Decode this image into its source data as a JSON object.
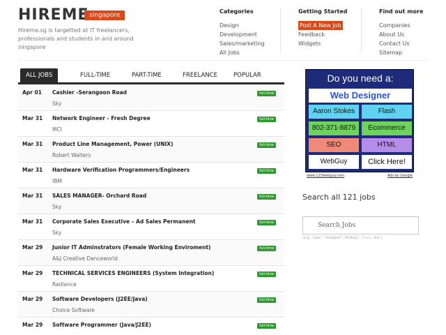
{
  "header": {
    "logo": "HIREME",
    "locale": "singapore",
    "tagline": "Hireme.sg is targetted at IT freelancers, professionals and students in and around singapore"
  },
  "nav": {
    "categories": {
      "heading": "Categories",
      "items": [
        "Design",
        "Development",
        "Sales/marketing",
        "All Jobs"
      ]
    },
    "getting_started": {
      "heading": "Getting Started",
      "items": [
        "Post A New Job",
        "Feedback",
        "Widgets"
      ]
    },
    "find_out_more": {
      "heading": "Find out more",
      "items": [
        "Companies",
        "About Us",
        "Contact Us",
        "Sitemap"
      ]
    }
  },
  "tabs": [
    "ALL JOBS",
    "FULL-TIME",
    "PART-TIME",
    "FREELANCE",
    "POPULAR"
  ],
  "jobs": [
    {
      "date": "Apr 01",
      "title": "Cashier -Serangoon Road",
      "company": "Sky",
      "type": "full-time"
    },
    {
      "date": "Mar 31",
      "title": "Network Engineer - Fresh Degree",
      "company": "MCI",
      "type": "full-time"
    },
    {
      "date": "Mar 31",
      "title": "Product Line Management, Power (UNIX)",
      "company": "Robert Walters",
      "type": "full-time"
    },
    {
      "date": "Mar 31",
      "title": "Hardware Verification Programmers/Engineers",
      "company": "IBM",
      "type": "full-time"
    },
    {
      "date": "Mar 31",
      "title": "SALES MANAGER- Orchard Road",
      "company": "Sky",
      "type": "full-time"
    },
    {
      "date": "Mar 31",
      "title": "Corporate Sales Executive – Ad Sales Permanent",
      "company": "Sky",
      "type": "full-time"
    },
    {
      "date": "Mar 29",
      "title": "Junior IT Adminstrators (Female Working Enviroment)",
      "company": "A&J Creative Danceworld",
      "type": "full-time"
    },
    {
      "date": "Mar 29",
      "title": "TECHNICAL SERVICES ENGINEERS (System Integration)",
      "company": "Radiance",
      "type": "full-time"
    },
    {
      "date": "Mar 29",
      "title": "Software Developers (J2EE/Java)",
      "company": "Choice Software",
      "type": "full-time"
    },
    {
      "date": "Mar 29",
      "title": "Software Programmer (Java/J2EE)",
      "company": "",
      "type": "full-time"
    }
  ],
  "ad": {
    "title": "Do you need a:",
    "headline": "Web Designer",
    "cells": [
      {
        "text": "Aaron Stokes",
        "bg": "#5fd3f0",
        "color": "#111111"
      },
      {
        "text": "Flash",
        "bg": "#5fd3f0",
        "color": "#111111"
      },
      {
        "text": "802-371-8879",
        "bg": "#6ed25c",
        "color": "#111111"
      },
      {
        "text": "Ecommerce",
        "bg": "#6ed25c",
        "color": "#111111"
      },
      {
        "text": "SEO",
        "bg": "#f08a78",
        "color": "#111111"
      },
      {
        "text": "HTML",
        "bg": "#b58de8",
        "color": "#111111"
      },
      {
        "text": "WebGuy",
        "bg": "#ffffff",
        "color": "#111111"
      },
      {
        "text": "Click Here!",
        "bg": "#ffffff",
        "color": "#111111"
      }
    ],
    "link_left": "www.123webguy.com",
    "link_right": "Ads by Google"
  },
  "search": {
    "title": "Search all 121 jobs",
    "placeholder": "Search Jobs",
    "hint": "(e.g. \"ajax\", \"designer\", bootlay\", \"c++, rita\")"
  },
  "colors": {
    "accent": "#d84a1b",
    "badge": "#2e9a2e",
    "tab_active": "#2a2a2a"
  }
}
